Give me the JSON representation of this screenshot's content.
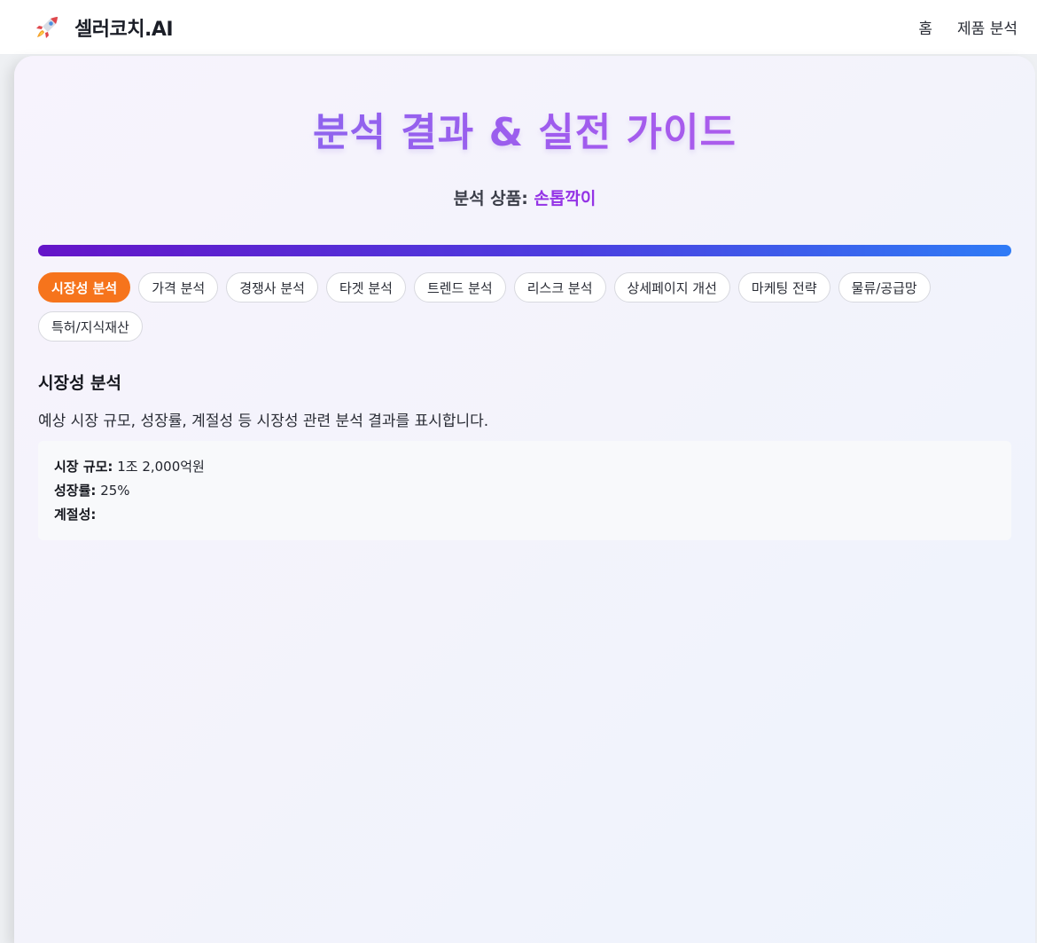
{
  "header": {
    "brand": "셀러코치.AI",
    "brand_icon": "rocket-icon",
    "nav": [
      "홈",
      "제품 분석"
    ]
  },
  "main": {
    "title": "분석 결과 & 실전 가이드",
    "product_label": "분석 상품:",
    "product_name": "손톱깍이",
    "tabs": [
      "시장성 분석",
      "가격 분석",
      "경쟁사 분석",
      "타겟 분석",
      "트렌드 분석",
      "리스크 분석",
      "상세페이지 개선",
      "마케팅 전략",
      "물류/공급망",
      "특허/지식재산"
    ],
    "active_tab": "시장성 분석",
    "section": {
      "title": "시장성 분석",
      "description": "예상 시장 규모, 성장률, 계절성 등 시장성 관련 분석 결과를 표시합니다.",
      "rows": [
        {
          "label": "시장 규모:",
          "value": "1조 2,000억원"
        },
        {
          "label": "성장률:",
          "value": "25%"
        },
        {
          "label": "계절성:",
          "value": ""
        }
      ]
    }
  },
  "colors": {
    "accent": "#f6741c",
    "title_gradient_start": "#7c6cf0",
    "title_gradient_end": "#c25cea",
    "product_name": "#9433e6",
    "progress_start": "#6514c8",
    "progress_end": "#2f7bf6"
  }
}
